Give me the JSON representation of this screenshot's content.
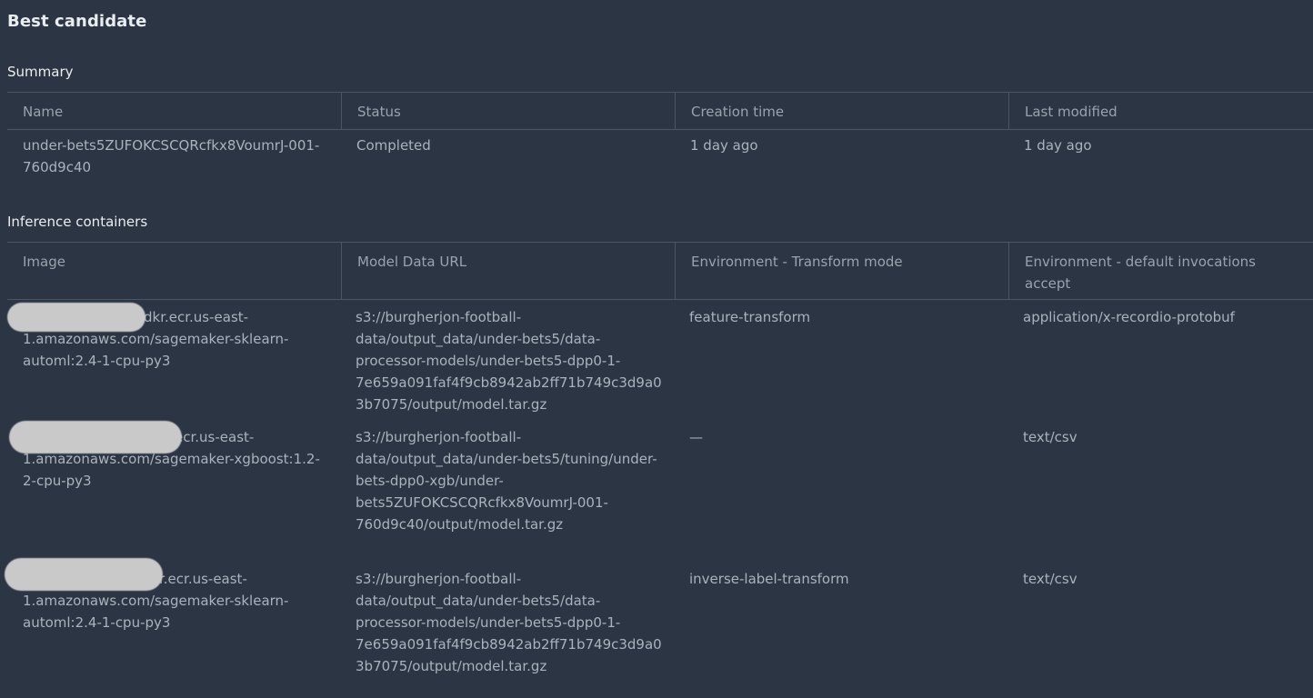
{
  "title": "Best candidate",
  "summary": {
    "heading": "Summary",
    "columns": [
      "Name",
      "Status",
      "Creation time",
      "Last modified"
    ],
    "row": {
      "name": "under-bets5ZUFOKCSCQRcfkx8VoumrJ-001-760d9c40",
      "status": "Completed",
      "creation_time": "1 day ago",
      "last_modified": "1 day ago"
    }
  },
  "inference_containers": {
    "heading": "Inference containers",
    "columns": [
      "Image",
      "Model Data URL",
      "Environment - Transform mode",
      "Environment - default invocations accept"
    ],
    "rows": [
      {
        "image": "dkr.ecr.us-east-1.amazonaws.com/sagemaker-sklearn-automl:2.4-1-cpu-py3",
        "model_data_url": "s3://burgherjon-football-data/output_data/under-bets5/data-processor-models/under-bets5-dpp0-1-7e659a091faf4f9cb8942ab2ff71b749c3d9a03b7075/output/model.tar.gz",
        "transform_mode": "feature-transform",
        "invocations_accept": "application/x-recordio-protobuf"
      },
      {
        "image": "ecr.us-east-1.amazonaws.com/sagemaker-xgboost:1.2-2-cpu-py3",
        "model_data_url": "s3://burgherjon-football-data/output_data/under-bets5/tuning/under-bets-dpp0-xgb/under-bets5ZUFOKCSCQRcfkx8VoumrJ-001-760d9c40/output/model.tar.gz",
        "transform_mode": "—",
        "invocations_accept": "text/csv"
      },
      {
        "image": "r.ecr.us-east-1.amazonaws.com/sagemaker-sklearn-automl:2.4-1-cpu-py3",
        "model_data_url": "s3://burgherjon-football-data/output_data/under-bets5/data-processor-models/under-bets5-dpp0-1-7e659a091faf4f9cb8942ab2ff71b749c3d9a03b7075/output/model.tar.gz",
        "transform_mode": "inverse-label-transform",
        "invocations_accept": "text/csv"
      }
    ]
  }
}
